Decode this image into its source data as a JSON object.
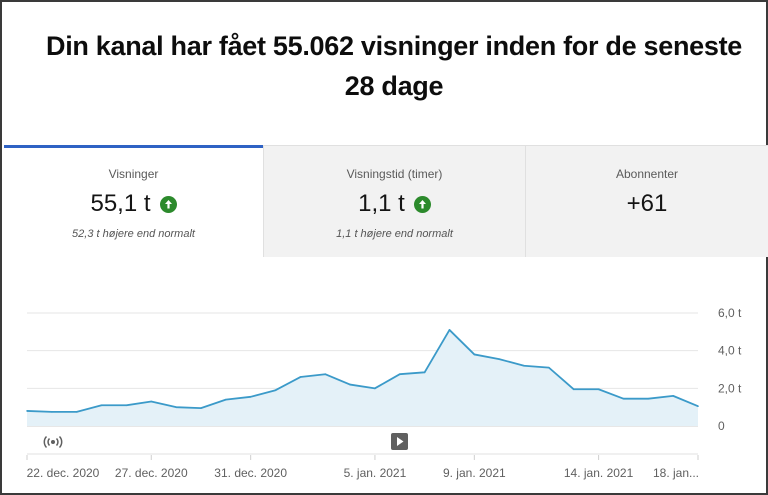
{
  "headline": "Din kanal har fået 55.062 visninger inden for de seneste 28 dage",
  "tabs": [
    {
      "label": "Visninger",
      "value": "55,1 t",
      "trend": "up",
      "note": "52,3 t højere end normalt",
      "selected": true
    },
    {
      "label": "Visningstid (timer)",
      "value": "1,1 t",
      "trend": "up",
      "note": "1,1 t højere end normalt",
      "selected": false
    },
    {
      "label": "Abonnenter",
      "value": "+61",
      "trend": "",
      "note": "",
      "selected": false
    }
  ],
  "colors": {
    "accent": "#2f62c4",
    "trend_up": "#2c8a2c",
    "line": "#3b9ac9",
    "area": "#e4f1f8"
  },
  "icons": {
    "trend": "arrow-up-icon",
    "live": "live-broadcast-icon",
    "video": "play-icon"
  },
  "chart_data": {
    "type": "area",
    "ylim": [
      0,
      6.0
    ],
    "y_ticks": [
      "0",
      "2,0 t",
      "4,0 t",
      "6,0 t"
    ],
    "y_tick_values": [
      0,
      2.0,
      4.0,
      6.0
    ],
    "x_tick_labels": [
      "22. dec. 2020",
      "27. dec. 2020",
      "31. dec. 2020",
      "5. jan. 2021",
      "9. jan. 2021",
      "14. jan. 2021",
      "18. jan..."
    ],
    "x_tick_index": [
      0,
      5,
      9,
      14,
      18,
      23,
      27
    ],
    "x": [
      "21. dec.",
      "22. dec.",
      "23. dec.",
      "24. dec.",
      "25. dec.",
      "26. dec.",
      "27. dec.",
      "28. dec.",
      "29. dec.",
      "30. dec.",
      "31. dec.",
      "1. jan.",
      "2. jan.",
      "3. jan.",
      "4. jan.",
      "5. jan.",
      "6. jan.",
      "7. jan.",
      "8. jan.",
      "9. jan.",
      "10. jan.",
      "11. jan.",
      "12. jan.",
      "13. jan.",
      "14. jan.",
      "15. jan.",
      "16. jan.",
      "17. jan.",
      "18. jan."
    ],
    "series": [
      {
        "values": [
          0.8,
          0.75,
          0.75,
          1.1,
          1.1,
          1.3,
          1.0,
          0.95,
          1.4,
          1.55,
          1.9,
          2.6,
          2.75,
          2.2,
          2.0,
          2.75,
          2.85,
          5.1,
          3.8,
          3.55,
          3.2,
          3.1,
          1.95,
          1.95,
          1.45,
          1.45,
          1.6,
          1.05
        ]
      }
    ],
    "grid": true,
    "legend": "none",
    "video_marker_index": 15,
    "live_marker_index": 1
  }
}
